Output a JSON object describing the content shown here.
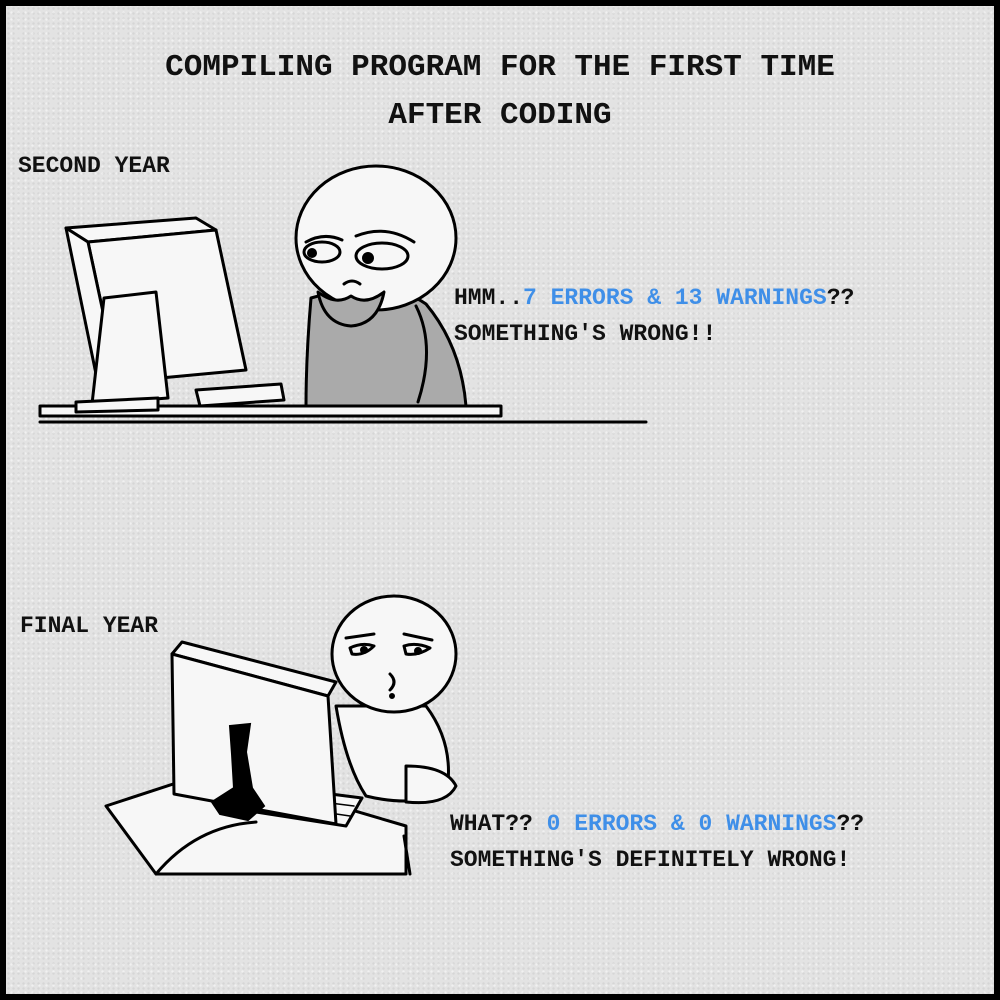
{
  "title": {
    "line1": "COMPILING PROGRAM FOR THE FIRST TIME",
    "line2": "AFTER CODING"
  },
  "panel1": {
    "label": "SECOND YEAR",
    "speech": {
      "line1_prefix": "HMM..",
      "line1_hl1": "7 ERRORS",
      "line1_mid": " & ",
      "line1_hl2": "13 WARNINGS",
      "line1_suffix": "??",
      "line2": "SOMETHING'S WRONG!!"
    }
  },
  "panel2": {
    "label": "FINAL YEAR",
    "speech": {
      "line1_prefix": "WHAT?? ",
      "line1_hl1": "0 ERRORS",
      "line1_mid": " & ",
      "line1_hl2": "0 WARNINGS",
      "line1_suffix": "??",
      "line2": "SOMETHING'S DEFINITELY WRONG!"
    }
  },
  "colors": {
    "background": "#e3e3e3",
    "frame": "#000000",
    "highlight": "#3f8fe8",
    "text": "#111111"
  }
}
